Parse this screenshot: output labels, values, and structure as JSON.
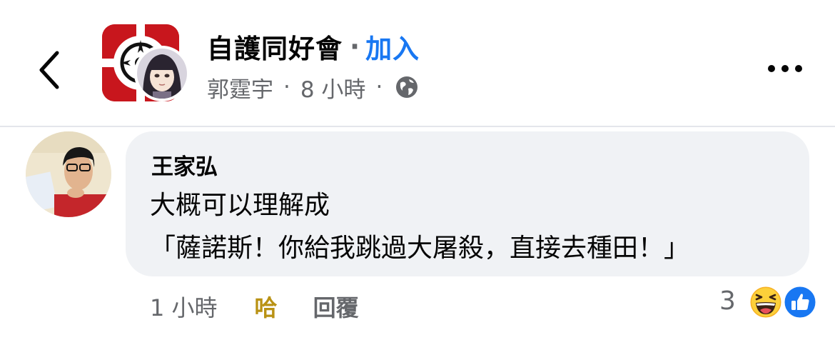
{
  "header": {
    "group_name": "自護同好會",
    "title_separator": "·",
    "join_label": "加入",
    "poster_name": "郭霆宇",
    "post_time": "8 小時",
    "meta_separator": "·",
    "visibility_icon": "globe-icon",
    "back_icon": "chevron-left-icon",
    "more_icon": "more-dots-icon"
  },
  "comment": {
    "author": "王家弘",
    "lines": [
      "大概可以理解成",
      "「薩諾斯！你給我跳過大屠殺，直接去種田！」"
    ],
    "time": "1 小時",
    "reaction_label": "哈",
    "reply_label": "回覆",
    "reaction_count": "3",
    "reaction_icons": [
      "haha-icon",
      "like-icon"
    ]
  },
  "colors": {
    "link_blue": "#1877f2",
    "haha_gold": "#b99214",
    "secondary_text": "#65676b",
    "bubble_bg": "#f0f2f5"
  }
}
